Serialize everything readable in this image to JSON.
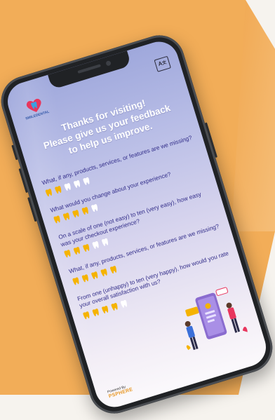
{
  "brand": {
    "logo_text": "SMILEDENTAL",
    "translate_icon": "translate-icon"
  },
  "headline": {
    "line1": "Thanks for visiting!",
    "line2": "Please give us your feedback",
    "line3": "to help us improve."
  },
  "questions": [
    {
      "text": "What, if any, products, services, or features are we missing?",
      "rating": 2,
      "max": 5
    },
    {
      "text": "What would you change about your experience?",
      "rating": 4,
      "max": 5
    },
    {
      "text": "On a scale of one (not easy) to ten (very easy), how easy was your checkout experience?",
      "rating": 3,
      "max": 5
    },
    {
      "text": "What, if any, products, services, or features are we missing?",
      "rating": 5,
      "max": 5
    },
    {
      "text": "From one (unhappy) to ten (very happy), how would you rate your overall satisfaction with us?",
      "rating": 4,
      "max": 5
    }
  ],
  "colors": {
    "tooth_filled": "#f5b301",
    "tooth_empty": "#ffffff",
    "question_text": "#332e8a"
  },
  "footer": {
    "powered_by": "Powered By",
    "powered_brand": "PSPHERE"
  }
}
